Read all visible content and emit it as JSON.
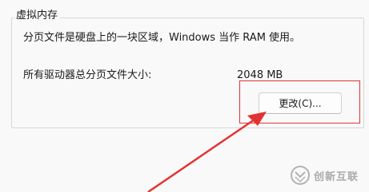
{
  "group": {
    "title": "虚拟内存"
  },
  "content": {
    "description": "分页文件是硬盘上的一块区域，Windows 当作 RAM 使用。",
    "size_label": "所有驱动器总分页文件大小:",
    "size_value": "2048 MB",
    "change_button_label": "更改(C)..."
  },
  "annotation": {
    "highlight_color": "#e33232"
  },
  "watermark": {
    "text": "创新互联"
  }
}
